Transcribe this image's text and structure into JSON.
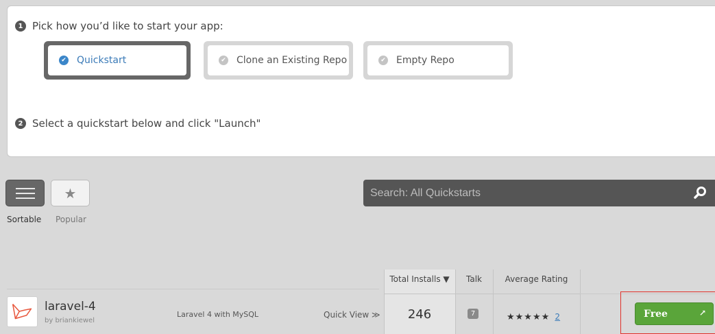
{
  "steps": {
    "step1": {
      "num": "1",
      "text": "Pick how you’d like to start your app:"
    },
    "step2": {
      "num": "2",
      "text": "Select a quickstart below and click \"Launch\""
    }
  },
  "start_options": [
    {
      "label": "Quickstart",
      "selected": true
    },
    {
      "label": "Clone an Existing Repo",
      "selected": false
    },
    {
      "label": "Empty Repo",
      "selected": false
    }
  ],
  "views": {
    "sortable_label": "Sortable",
    "popular_label": "Popular"
  },
  "search": {
    "placeholder": "Search: All Quickstarts"
  },
  "table": {
    "headers": {
      "installs": "Total Installs ▼",
      "talk": "Talk",
      "rating": "Average Rating"
    },
    "rows": [
      {
        "name": "laravel-4",
        "author": "by briankiewel",
        "description": "Laravel 4 with MySQL",
        "quick_view": "Quick View ≫",
        "installs": "246",
        "talk": "7",
        "stars": "★★★★★",
        "rating_count": "2",
        "price_button": "Free",
        "price_icon": "↗"
      }
    ]
  },
  "colors": {
    "accent_blue": "#3b7bb8",
    "free_green": "#5aa53a",
    "highlight_red": "#e0302a",
    "search_bg": "#555555"
  }
}
